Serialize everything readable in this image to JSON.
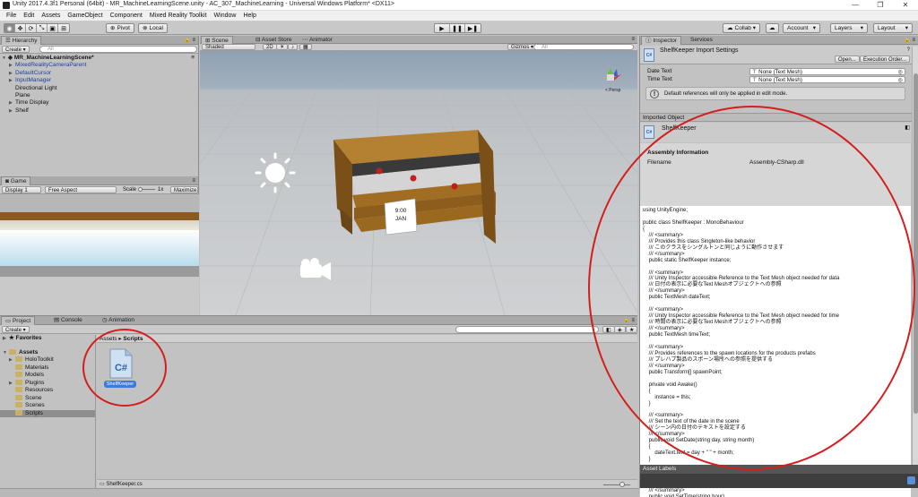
{
  "window": {
    "title": "Unity 2017.4.3f1 Personal (64bit) - MR_MachineLearningScene.unity - AC_307_MachineLearning - Universal Windows Platform* <DX11>",
    "controls": [
      "—",
      "❐",
      "✕"
    ]
  },
  "menu": [
    "File",
    "Edit",
    "Assets",
    "GameObject",
    "Component",
    "Mixed Reality Toolkit",
    "Window",
    "Help"
  ],
  "toolbar": {
    "pivot": "Pivot",
    "local": "Local",
    "collab": "Collab ▾",
    "account": "Account",
    "layers": "Layers",
    "layout": "Layout"
  },
  "hierarchy": {
    "tab": "Hierarchy",
    "create": "Create ▾",
    "search_placeholder": "All",
    "scene": "MR_MachineLearningScene*",
    "items": [
      {
        "label": "MixedRealityCameraParent",
        "prefab": true,
        "expandable": true
      },
      {
        "label": "DefaultCursor",
        "prefab": true,
        "expandable": true
      },
      {
        "label": "InputManager",
        "prefab": true,
        "expandable": true
      },
      {
        "label": "Directional Light",
        "prefab": false,
        "expandable": false
      },
      {
        "label": "Plane",
        "prefab": false,
        "expandable": false
      },
      {
        "label": "Time Display",
        "prefab": false,
        "expandable": true
      },
      {
        "label": "Shelf",
        "prefab": false,
        "expandable": true
      }
    ]
  },
  "game": {
    "tab": "Game",
    "display": "Display 1",
    "aspect": "Free Aspect",
    "scale_label": "Scale",
    "scale_value": "1x",
    "maximize": "Maximize"
  },
  "scene": {
    "tabs": [
      "Scene",
      "Asset Store",
      "Animator"
    ],
    "shading": "Shaded",
    "mode": "2D",
    "gizmos": "Gizmos ▾",
    "search_placeholder": "All",
    "sign_time": "9:00",
    "sign_month": "JAN",
    "persp": "< Persp"
  },
  "project": {
    "tabs": [
      "Project",
      "Console",
      "Animation"
    ],
    "create": "Create ▾",
    "favorites": "Favorites",
    "assets": "Assets",
    "folders": [
      "HoloToolkit",
      "Materials",
      "Models",
      "Plugins",
      "Resources",
      "Scene",
      "Scenes",
      "Scripts"
    ],
    "breadcrumb": [
      "Assets",
      "Scripts"
    ],
    "file_name": "ShelfKeeper",
    "footer_file": "ShelfKeeper.cs"
  },
  "inspector": {
    "tabs": [
      "Inspector",
      "Services"
    ],
    "title": "ShelfKeeper Import Settings",
    "open_btn": "Open...",
    "exec_btn": "Execution Order...",
    "fields": [
      {
        "label": "Date Text",
        "value": "None (Text Mesh)"
      },
      {
        "label": "Time Text",
        "value": "None (Text Mesh)"
      }
    ],
    "info": "Default references will only be applied in edit mode.",
    "imported_object": "Imported Object",
    "object_name": "ShelfKeeper",
    "assembly_info": "Assembly Information",
    "filename_label": "Filename",
    "filename_value": "Assembly-CSharp.dll",
    "code_lines": [
      "using UnityEngine;",
      "",
      "public class ShelfKeeper : MonoBehaviour",
      "{",
      "    /// <summary>",
      "    /// Provides this class Singleton-like behavior",
      "    /// このクラスをシングルトンと同じように動作させます",
      "    /// </summary>",
      "    public static ShelfKeeper instance;",
      "",
      "    /// <summary>",
      "    /// Unity Inspector accessible Reference to the Text Mesh object needed for data",
      "    /// 日付の表示に必要なText Meshオブジェクトへの参照",
      "    /// </summary>",
      "    public TextMesh dateText;",
      "",
      "    /// <summary>",
      "    /// Unity Inspector accessible Reference to the Text Mesh object needed for time",
      "    /// 時間の表示に必要なText Meshオブジェクトへの参照",
      "    /// </summary>",
      "    public TextMesh timeText;",
      "",
      "    /// <summary>",
      "    /// Provides references to the spawn locations for the products prefabs",
      "    /// プレハブ製品のスポーン場所への参照を提供する",
      "    /// </summary>",
      "    public Transform[] spawnPoint;",
      "",
      "    private void Awake()",
      "    {",
      "        instance = this;",
      "    }",
      "",
      "    /// <summary>",
      "    /// Set the text of the date in the scene",
      "    /// シーン内の日付のテキストを設定する",
      "    /// </summary>",
      "    public void SetDate(string day, string month)",
      "    {",
      "        dateText.text = day + \" \" + month;",
      "    }",
      "",
      "    /// <summary>",
      "    /// Set the text of the time in the scene",
      "    /// シーンの時間のテキストを設定する",
      "    /// </summary>",
      "    public void SetTime(string hour)"
    ],
    "asset_labels": "Asset Labels"
  },
  "colors": {
    "annotation_red": "#d41e1e",
    "selection_blue": "#3d7bd9",
    "shelf_wood": "#a8772a"
  }
}
